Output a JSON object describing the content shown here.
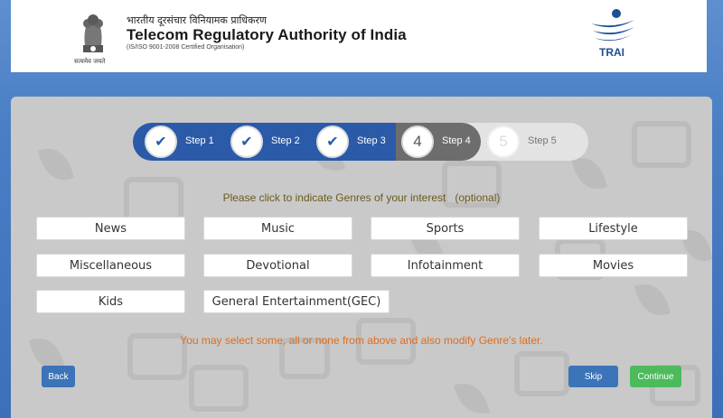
{
  "header": {
    "hindi_title": "भारतीय दूरसंचार विनियामक प्राधिकरण",
    "title": "Telecom Regulatory Authority of India",
    "subtitle": "(IS/ISO 9001-2008 Certified Organisation)",
    "emblem_caption": "सत्यमेव जयते",
    "logo_text": "TRAI",
    "brand_color": "#1d4f93"
  },
  "stepper": {
    "steps": [
      {
        "number": "1",
        "label": "Step 1",
        "status": "done"
      },
      {
        "number": "2",
        "label": "Step 2",
        "status": "done"
      },
      {
        "number": "3",
        "label": "Step 3",
        "status": "done"
      },
      {
        "number": "4",
        "label": "Step 4",
        "status": "current"
      },
      {
        "number": "5",
        "label": "Step 5",
        "status": "upcoming"
      }
    ],
    "done_icon": "check-icon",
    "done_color": "#2b5aa8",
    "current_color": "#6d6d6d"
  },
  "prompt": "Please click to indicate Genres of your interest   (optional)",
  "genres": [
    "News",
    "Music",
    "Sports",
    "Lifestyle",
    "Miscellaneous",
    "Devotional",
    "Infotainment",
    "Movies",
    "Kids",
    "General Entertainment(GEC)"
  ],
  "note": "You may select some, all or none from above and also modify Genre's later.",
  "buttons": {
    "back": "Back",
    "skip": "Skip",
    "continue": "Continue"
  }
}
